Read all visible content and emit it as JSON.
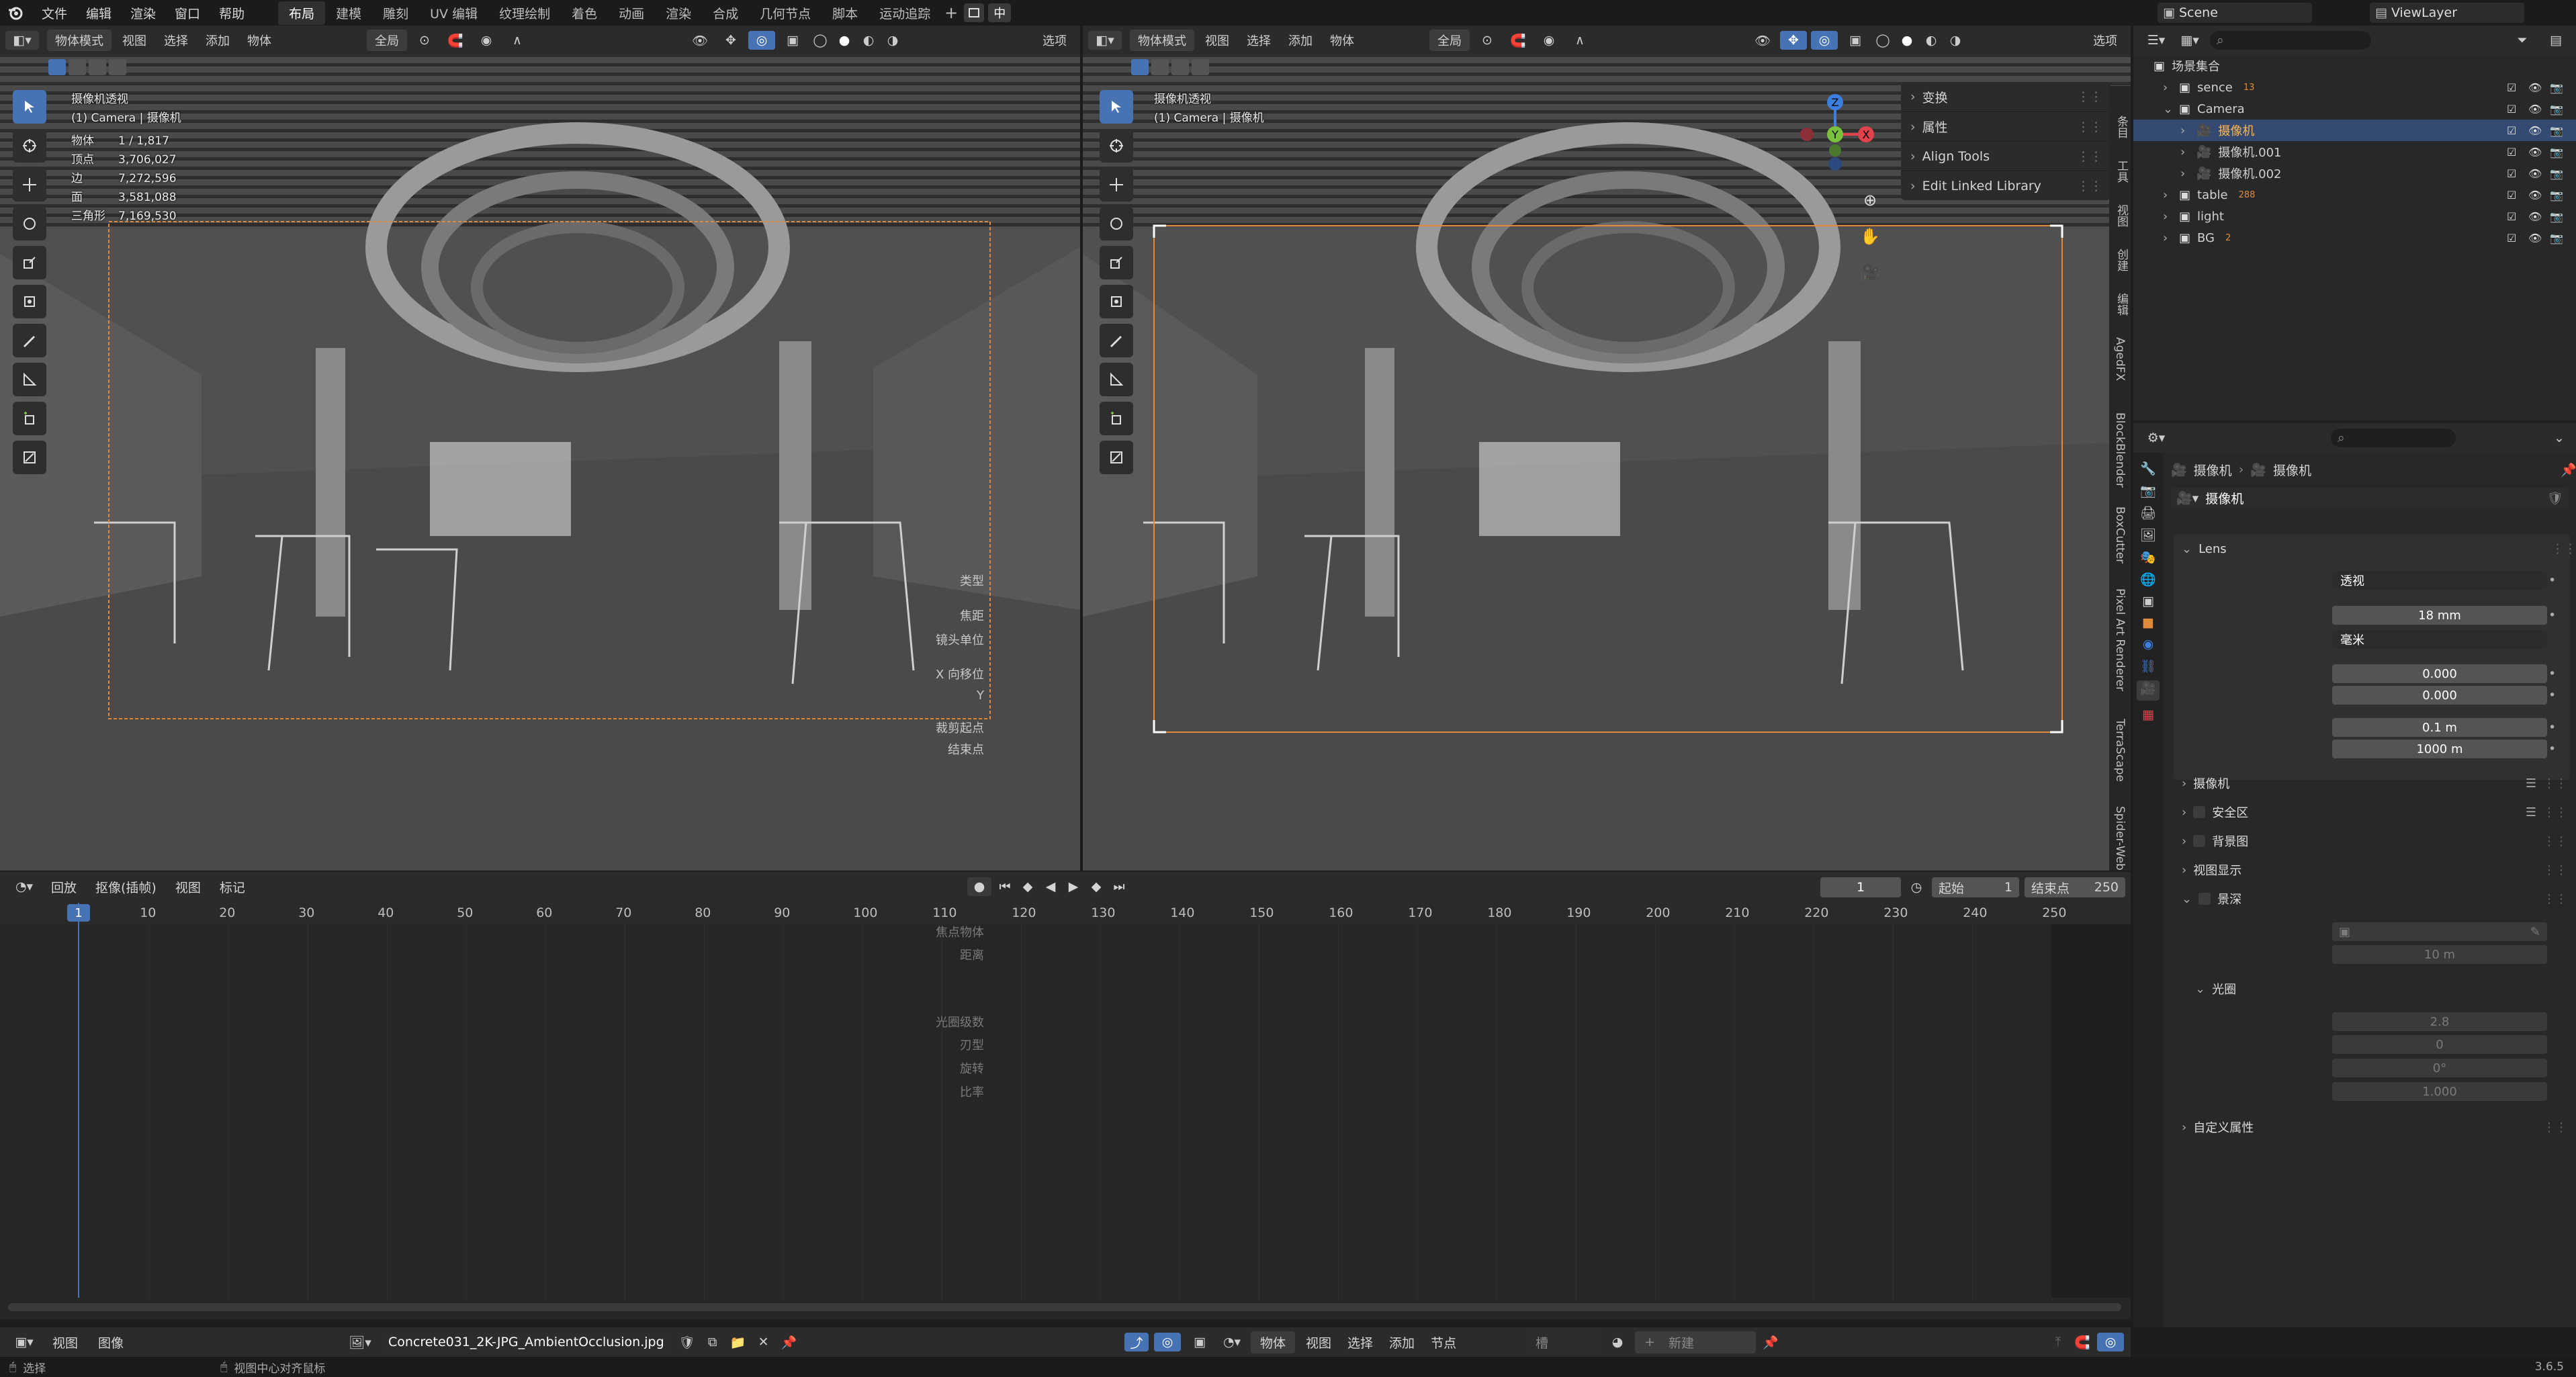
{
  "menubar": {
    "items": [
      "文件",
      "编辑",
      "渲染",
      "窗口",
      "帮助"
    ],
    "workspaces": [
      "布局",
      "建模",
      "雕刻",
      "UV 编辑",
      "纹理绘制",
      "着色",
      "动画",
      "渲染",
      "合成",
      "几何节点",
      "脚本",
      "运动追踪"
    ],
    "active_workspace": "布局",
    "scene": "Scene",
    "view_layer": "ViewLayer",
    "lang": "中"
  },
  "viewport_left": {
    "mode": "物体模式",
    "menus": [
      "视图",
      "选择",
      "添加",
      "物体"
    ],
    "orientation": "全局",
    "options": "选项",
    "view_name": "摄像机透视",
    "camera_line": "(1) Camera | 摄像机",
    "stats": [
      [
        "物体",
        "1 / 1,817"
      ],
      [
        "顶点",
        "3,706,027"
      ],
      [
        "边",
        "7,272,596"
      ],
      [
        "面",
        "3,581,088"
      ],
      [
        "三角形",
        "7,169,530"
      ]
    ]
  },
  "viewport_right": {
    "mode": "物体模式",
    "menus": [
      "视图",
      "选择",
      "添加",
      "物体"
    ],
    "orientation": "全局",
    "options": "选项",
    "view_name": "摄像机透视",
    "camera_line": "(1) Camera | 摄像机",
    "npanel": [
      "变换",
      "属性",
      "Align Tools",
      "Edit Linked Library"
    ],
    "tabs": [
      "条目",
      "工具",
      "视图",
      "创建",
      "编辑",
      "AgedFX",
      "BlockBlender",
      "BoxCutter",
      "Pixel Art Renderer",
      "TerraScape",
      "Spider-Web"
    ]
  },
  "timeline": {
    "menus": [
      "回放",
      "抠像(插帧)",
      "视图",
      "标记"
    ],
    "current_frame": "1",
    "start_label": "起始",
    "start": "1",
    "end_label": "结束点",
    "end": "250",
    "ticks": [
      "1",
      "10",
      "20",
      "30",
      "40",
      "50",
      "60",
      "70",
      "80",
      "90",
      "100",
      "110",
      "120",
      "130",
      "140",
      "150",
      "160",
      "170",
      "180",
      "190",
      "200",
      "210",
      "220",
      "230",
      "240",
      "250"
    ]
  },
  "image_editor": {
    "menus": [
      "视图",
      "图像"
    ],
    "image_name": "Concrete031_2K-JPG_AmbientOcclusion.jpg"
  },
  "node_editor": {
    "object": "物体",
    "menus": [
      "视图",
      "选择",
      "添加",
      "节点"
    ],
    "slot": "槽",
    "new": "新建"
  },
  "status": {
    "left": "选择",
    "middle": "视图中心对齐鼠标",
    "version": "3.6.5"
  },
  "outliner": {
    "root": "场景集合",
    "items": [
      {
        "name": "sence",
        "badge": "13",
        "level": 1,
        "expanded": false
      },
      {
        "name": "Camera",
        "badge": "",
        "level": 1,
        "expanded": true
      },
      {
        "name": "摄像机",
        "badge": "",
        "level": 2,
        "selected": true
      },
      {
        "name": "摄像机.001",
        "badge": "",
        "level": 2
      },
      {
        "name": "摄像机.002",
        "badge": "",
        "level": 2
      },
      {
        "name": "table",
        "badge": "288",
        "level": 1
      },
      {
        "name": "light",
        "badge": "",
        "level": 1
      },
      {
        "name": "BG",
        "badge": "2",
        "level": 1
      }
    ]
  },
  "properties": {
    "breadcrumb": [
      "摄像机",
      "摄像机"
    ],
    "datablock": "摄像机",
    "lens_title": "Lens",
    "type_label": "类型",
    "type": "透视",
    "focal_label": "焦距",
    "focal": "18 mm",
    "unit_label": "镜头单位",
    "unit": "毫米",
    "shiftx_label": "X 向移位",
    "shiftx": "0.000",
    "shifty_label": "Y",
    "shifty": "0.000",
    "clip_start_label": "裁剪起点",
    "clip_start": "0.1 m",
    "clip_end_label": "结束点",
    "clip_end": "1000 m",
    "sections": [
      "摄像机",
      "安全区",
      "背景图",
      "视图显示",
      "景深"
    ],
    "focus_obj_label": "焦点物体",
    "distance_label": "距离",
    "distance": "10 m",
    "aperture": "光圈",
    "fstop_label": "光圈级数",
    "fstop": "2.8",
    "blades_label": "刃型",
    "blades": "0",
    "rotation_label": "旋转",
    "rotation": "0°",
    "ratio_label": "比率",
    "ratio": "1.000",
    "custom": "自定义属性"
  },
  "colors": {
    "accent": "#4772b3",
    "camera_frame": "#e08a3c",
    "selected_row": "#344a72",
    "axis_x": "#e0424c",
    "axis_y": "#7ac13d",
    "axis_z": "#3c7fe0"
  }
}
